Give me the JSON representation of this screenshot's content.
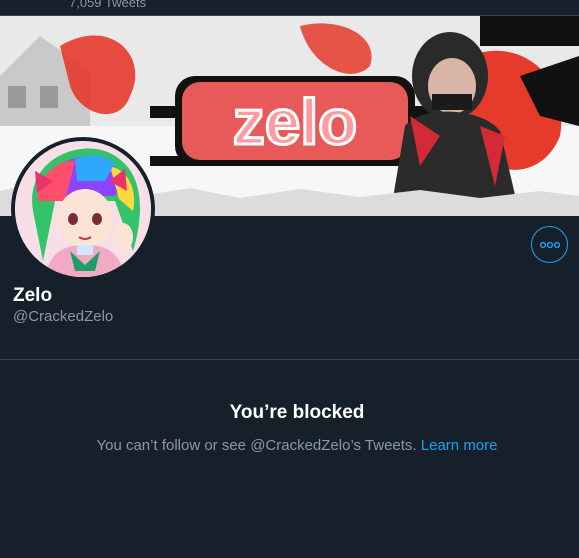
{
  "header": {
    "tweet_count": "7,059 Tweets"
  },
  "banner": {
    "logo_text": "zelo"
  },
  "profile": {
    "display_name": "Zelo",
    "handle": "@CrackedZelo",
    "more_button_icon": "more-horizontal-icon"
  },
  "blocked": {
    "title": "You’re blocked",
    "message": "You can’t follow or see @CrackedZelo’s Tweets.",
    "learn_more": "Learn more"
  },
  "colors": {
    "background": "#15202b",
    "accent": "#1da1f2",
    "secondary_text": "#8899a6",
    "border": "#38444d"
  }
}
